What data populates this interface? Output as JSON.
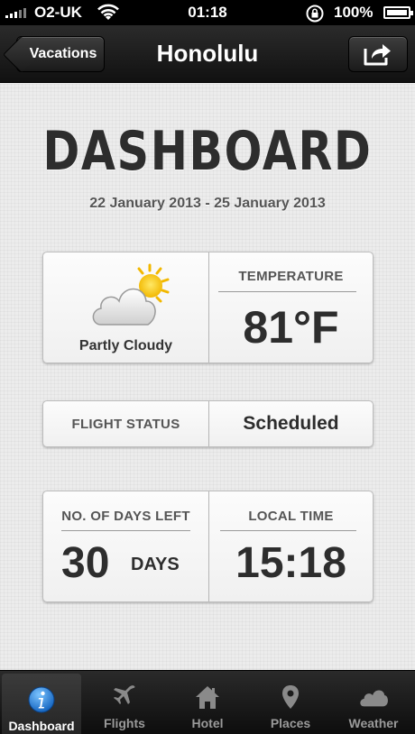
{
  "status_bar": {
    "carrier": "O2-UK",
    "time": "01:18",
    "battery": "100%"
  },
  "nav": {
    "back_label": "Vacations",
    "title": "Honolulu",
    "share_icon": "share-icon"
  },
  "dashboard": {
    "title": "DASHBOARD",
    "date_range": "22 January 2013 - 25 January 2013",
    "weather": {
      "icon": "partly-cloudy-icon",
      "condition": "Partly Cloudy",
      "temperature_label": "TEMPERATURE",
      "temperature_value": "81°F"
    },
    "flight": {
      "label": "FLIGHT STATUS",
      "value": "Scheduled"
    },
    "days": {
      "label": "NO. OF DAYS LEFT",
      "value": "30",
      "unit": "DAYS"
    },
    "local_time": {
      "label": "LOCAL TIME",
      "value": "15:18"
    }
  },
  "tabs": [
    {
      "label": "Dashboard",
      "icon": "info-icon",
      "active": true
    },
    {
      "label": "Flights",
      "icon": "airplane-icon",
      "active": false
    },
    {
      "label": "Hotel",
      "icon": "house-icon",
      "active": false
    },
    {
      "label": "Places",
      "icon": "map-pin-icon",
      "active": false
    },
    {
      "label": "Weather",
      "icon": "cloud-icon",
      "active": false
    }
  ],
  "colors": {
    "accent_blue": "#2f8fe0",
    "text_dark": "#2d2d2d"
  }
}
